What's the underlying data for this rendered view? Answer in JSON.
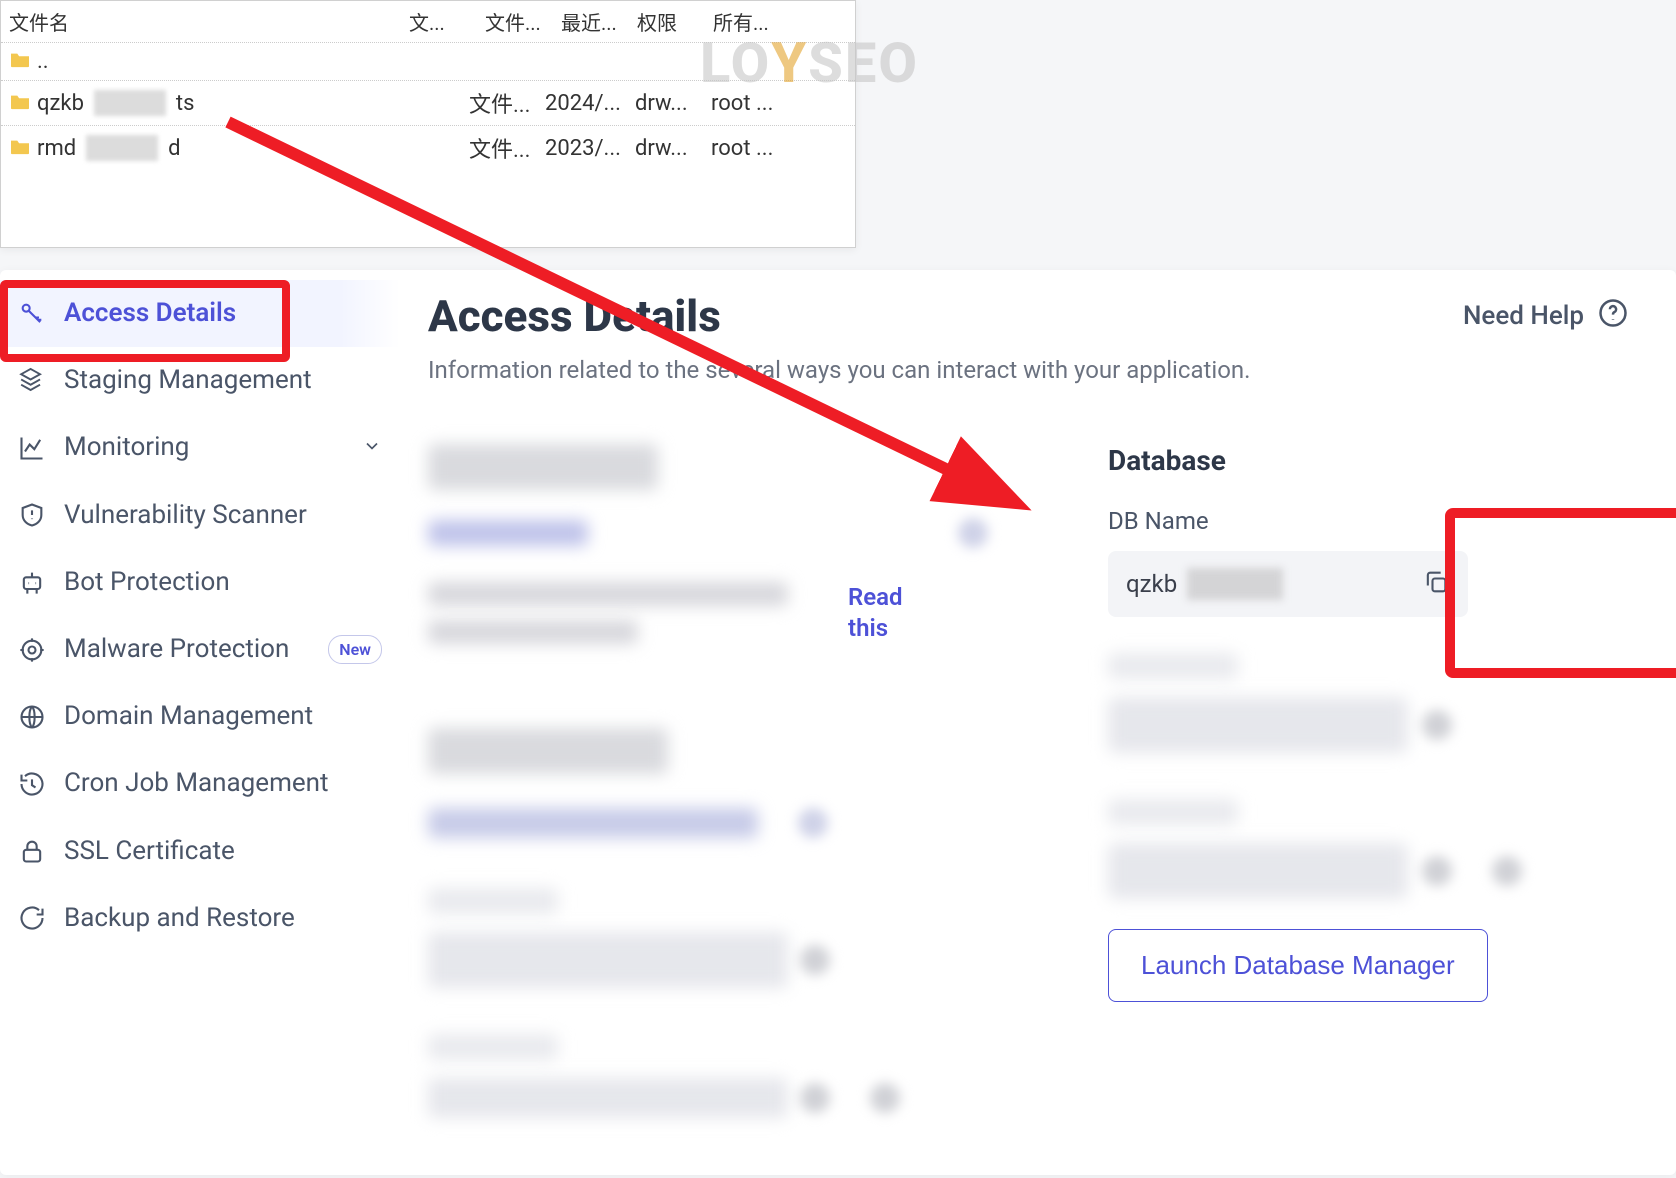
{
  "watermark": "LOYSEO",
  "file_browser": {
    "headers": {
      "name": "文件名",
      "type": "文...",
      "size": "文件...",
      "date": "最近...",
      "perm": "权限",
      "owner": "所有..."
    },
    "rows": [
      {
        "name_pre": "..",
        "type": "",
        "size": "",
        "date": "",
        "perm": "",
        "owner": ""
      },
      {
        "name_pre": "qzkb",
        "name_post": "ts",
        "type": "文件...",
        "date": "2024/...",
        "perm": "drw...",
        "owner": "root ..."
      },
      {
        "name_pre": "rmd",
        "name_post": "d",
        "type": "文件...",
        "date": "2023/...",
        "perm": "drw...",
        "owner": "root ..."
      }
    ]
  },
  "sidebar": {
    "items": [
      {
        "label": "Access Details"
      },
      {
        "label": "Staging Management"
      },
      {
        "label": "Monitoring"
      },
      {
        "label": "Vulnerability Scanner"
      },
      {
        "label": "Bot Protection"
      },
      {
        "label": "Malware Protection",
        "badge": "New"
      },
      {
        "label": "Domain Management"
      },
      {
        "label": "Cron Job Management"
      },
      {
        "label": "SSL Certificate"
      },
      {
        "label": "Backup and Restore"
      }
    ]
  },
  "header": {
    "title": "Access Details",
    "help": "Need Help",
    "subtitle": "Information related to the several ways you can interact with your application."
  },
  "left": {
    "read_this_1": "Read",
    "read_this_2": "this"
  },
  "database": {
    "section": "Database",
    "name_label": "DB Name",
    "name_value": "qzkb",
    "launch_btn": "Launch Database Manager"
  }
}
